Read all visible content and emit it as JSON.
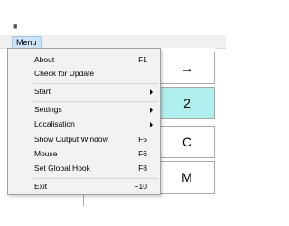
{
  "menubar": {
    "menu_label": "Menu"
  },
  "grid": {
    "cells": [
      "→",
      "2",
      "C",
      "M"
    ]
  },
  "menu": {
    "items": [
      {
        "label": "About",
        "shortcut": "F1"
      },
      {
        "label": "Check for Update",
        "shortcut": ""
      },
      {
        "label": "Start",
        "submenu": true
      },
      {
        "label": "Settings",
        "submenu": true
      },
      {
        "label": "Localisation",
        "submenu": true
      },
      {
        "label": "Show Output Window",
        "shortcut": "F5"
      },
      {
        "label": "Mouse",
        "shortcut": "F6"
      },
      {
        "label": "Set Global Hook",
        "shortcut": "F8"
      },
      {
        "label": "Exit",
        "shortcut": "F10"
      }
    ]
  },
  "icons": {
    "app": "app-icon"
  },
  "colors": {
    "highlight_cell": "#aeeeed",
    "menu_title_bg": "#cce4f7"
  }
}
